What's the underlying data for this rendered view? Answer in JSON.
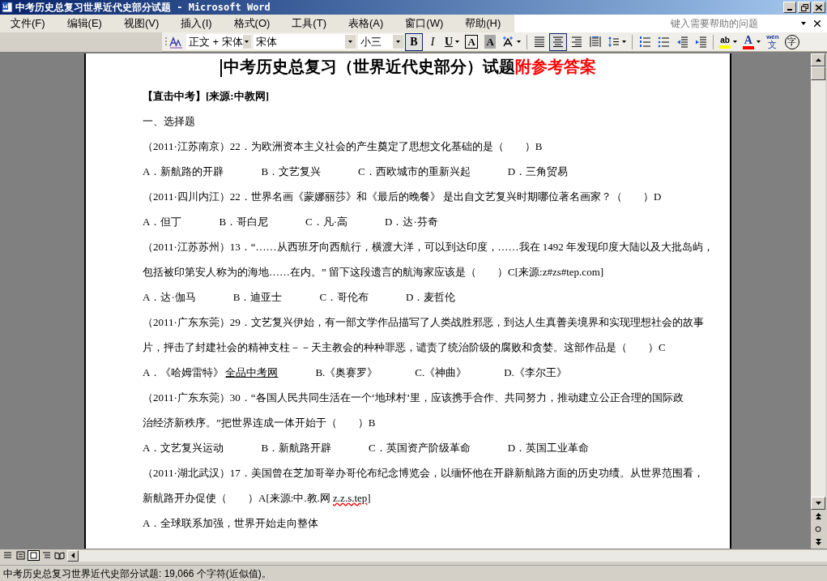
{
  "window": {
    "title": "中考历史总复习世界近代史部分试题 - Microsoft Word"
  },
  "menu": [
    "文件(F)",
    "编辑(E)",
    "视图(V)",
    "插入(I)",
    "格式(O)",
    "工具(T)",
    "表格(A)",
    "窗口(W)",
    "帮助(H)"
  ],
  "help_box": {
    "placeholder": "键入需要帮助的问题"
  },
  "toolbar": {
    "style": "正文 + 宋体",
    "font": "宋体",
    "size": "小三",
    "buttons": [
      {
        "kind": "bold",
        "label": "B",
        "selected": true
      },
      {
        "kind": "italic",
        "label": "I",
        "selected": false
      },
      {
        "kind": "underline",
        "label": "U",
        "selected": false
      },
      {
        "kind": "border-char",
        "label": "A",
        "selected": false
      },
      {
        "kind": "shade-char",
        "label": "A",
        "selected": false
      },
      {
        "kind": "scale",
        "selected": false
      },
      {
        "kind": "sep"
      },
      {
        "kind": "align-left",
        "selected": false
      },
      {
        "kind": "align-center",
        "selected": true
      },
      {
        "kind": "align-right",
        "selected": false
      },
      {
        "kind": "distribute",
        "selected": false
      },
      {
        "kind": "line-spacing",
        "selected": false
      },
      {
        "kind": "sep"
      },
      {
        "kind": "numbering",
        "selected": false
      },
      {
        "kind": "bullets",
        "selected": false
      },
      {
        "kind": "outdent",
        "selected": false
      },
      {
        "kind": "indent",
        "selected": false
      },
      {
        "kind": "sep"
      },
      {
        "kind": "highlight",
        "label": "ab",
        "selected": false
      },
      {
        "kind": "font-color",
        "label": "A",
        "selected": false
      },
      {
        "kind": "phonetic",
        "label": "文",
        "ruby": "wén",
        "selected": false
      },
      {
        "kind": "enclose",
        "label": "字",
        "selected": false
      }
    ]
  },
  "document": {
    "lines": [
      {
        "kind": "title",
        "segments": [
          {
            "kind": "normal",
            "text": "中考历史总复习（世界近代史部分）试题"
          },
          {
            "kind": "accent",
            "text": "附参考答案"
          }
        ]
      },
      {
        "kind": "bold",
        "segments": [
          {
            "kind": "normal",
            "text": "【直击中考】[来源:中教网]"
          }
        ]
      },
      {
        "kind": "text",
        "segments": [
          {
            "kind": "normal",
            "text": "一、选择题"
          }
        ]
      },
      {
        "kind": "text",
        "segments": [
          {
            "kind": "normal",
            "text": "（2011·江苏南京）22．为欧洲资本主义社会的产生奠定了思想文化基础的是（　　）B"
          }
        ]
      },
      {
        "kind": "options",
        "options": [
          {
            "text": "A．新航路的开辟"
          },
          {
            "text": "B．文艺复兴"
          },
          {
            "text": "C．西欧城市的重新兴起"
          },
          {
            "text": "D．三角贸易"
          }
        ]
      },
      {
        "kind": "text",
        "segments": [
          {
            "kind": "normal",
            "text": "（2011·四川内江）22．世界名画《蒙娜丽莎》和《最后的晚餐》 是出自文艺复兴时期哪位著名画家？（　　）D"
          }
        ]
      },
      {
        "kind": "options",
        "options": [
          {
            "text": "A．但丁"
          },
          {
            "text": "B．哥白尼"
          },
          {
            "text": "C．凡·高"
          },
          {
            "text": "D．达·芬奇"
          }
        ]
      },
      {
        "kind": "text",
        "segments": [
          {
            "kind": "normal",
            "text": "（2011·江苏苏州）13．“……从西班牙向西航行，横渡大洋，可以到达印度，……我在 1492 年发现印度大陆以及大批岛屿，"
          }
        ]
      },
      {
        "kind": "text",
        "segments": [
          {
            "kind": "normal",
            "text": "包括被印第安人称为的海地……在内。” 留下这段遗言的航海家应该是（　　）C[来源:z#zs#tep.com]"
          }
        ]
      },
      {
        "kind": "options",
        "options": [
          {
            "text": "A．达·伽马"
          },
          {
            "text": "B．迪亚士"
          },
          {
            "text": "C．哥伦布"
          },
          {
            "text": "D．麦哲伦"
          }
        ]
      },
      {
        "kind": "text",
        "segments": [
          {
            "kind": "normal",
            "text": "（2011·广东东莞）29．文艺复兴伊始，有一部文学作品描写了人类战胜邪恶，到达人生真善美境界和实现理想社会的故事"
          }
        ]
      },
      {
        "kind": "text",
        "segments": [
          {
            "kind": "normal",
            "text": "片，抨击了封建社会的精神支柱－－天主教会的种种罪恶，谴责了统治阶级的腐败和贪婪。这部作品是（　　）C"
          }
        ]
      },
      {
        "kind": "options",
        "options": [
          {
            "text": "A．《哈姆雷特》",
            "link": "全品中考网"
          },
          {
            "text": "B.《奥赛罗》"
          },
          {
            "text": "C.《神曲》"
          },
          {
            "text": "D.《李尔王》"
          }
        ]
      },
      {
        "kind": "text",
        "segments": [
          {
            "kind": "normal",
            "text": "（2011·广东东莞）30．“各国人民共同生活在一个‘地球村’里，应该携手合作、共同努力，推动建立公正合理的国际政"
          }
        ]
      },
      {
        "kind": "text",
        "segments": [
          {
            "kind": "normal",
            "text": "治经济新秩序。”把世界连成一体开始于（　　）B"
          }
        ]
      },
      {
        "kind": "options",
        "options": [
          {
            "text": "A．文艺复兴运动"
          },
          {
            "text": "B．新航路开辟"
          },
          {
            "text": "C．英国资产阶级革命"
          },
          {
            "text": "D．英国工业革命"
          }
        ]
      },
      {
        "kind": "text",
        "segments": [
          {
            "kind": "normal",
            "text": "（2011·湖北武汉）17．美国曾在芝加哥举办哥伦布纪念博览会，以缅怀他在开辟新航路方面的历史功绩。从世界范围看，"
          }
        ]
      },
      {
        "kind": "text",
        "segments": [
          {
            "kind": "normal",
            "text": "新航路开办促使（　　）A[来源:中.教.网 "
          },
          {
            "kind": "misspelled",
            "text": "z.z.s.tep"
          },
          {
            "kind": "normal",
            "text": "]"
          }
        ]
      },
      {
        "kind": "text",
        "segments": [
          {
            "kind": "normal",
            "text": "A．全球联系加强，世界开始走向整体"
          }
        ]
      }
    ]
  },
  "status_bar": "中考历史总复习世界近代史部分试题: 19,066 个字符(近似值)。"
}
